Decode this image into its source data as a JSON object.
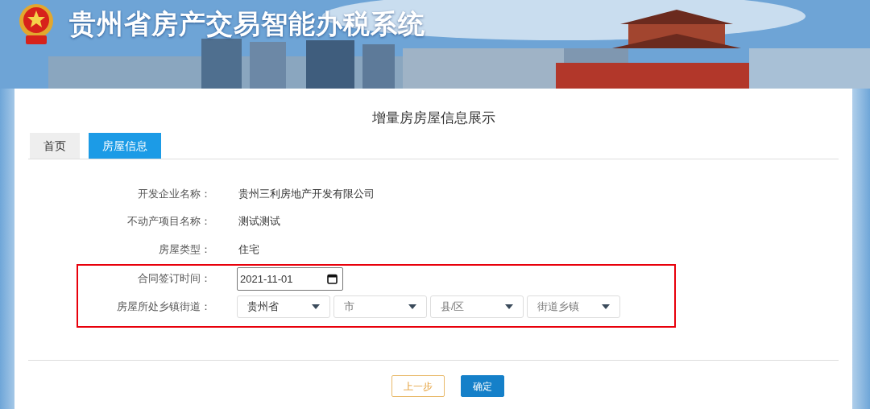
{
  "header": {
    "title": "贵州省房产交易智能办税系统"
  },
  "page_title": "增量房房屋信息展示",
  "tabs": [
    {
      "label": "首页",
      "selected": false
    },
    {
      "label": "房屋信息",
      "selected": true
    }
  ],
  "fields": [
    {
      "kind": "text",
      "label": "开发企业名称：",
      "value": "贵州三利房地产开发有限公司",
      "highlighted": false
    },
    {
      "kind": "text",
      "label": "不动产项目名称：",
      "value": "测试测试",
      "highlighted": false
    },
    {
      "kind": "text",
      "label": "房屋类型：",
      "value": "住宅",
      "highlighted": false
    },
    {
      "kind": "date",
      "label": "合同签订时间：",
      "value": "2021-11-01",
      "highlighted": true
    },
    {
      "kind": "selects",
      "label": "房屋所处乡镇街道：",
      "highlighted": true,
      "options": [
        {
          "value": "贵州省"
        },
        {
          "placeholder": "市"
        },
        {
          "placeholder": "县/区"
        },
        {
          "placeholder": "街道乡镇"
        }
      ]
    }
  ],
  "buttons": [
    {
      "label": "上一步",
      "kind": "secondary"
    },
    {
      "label": "确定",
      "kind": "primary"
    }
  ]
}
